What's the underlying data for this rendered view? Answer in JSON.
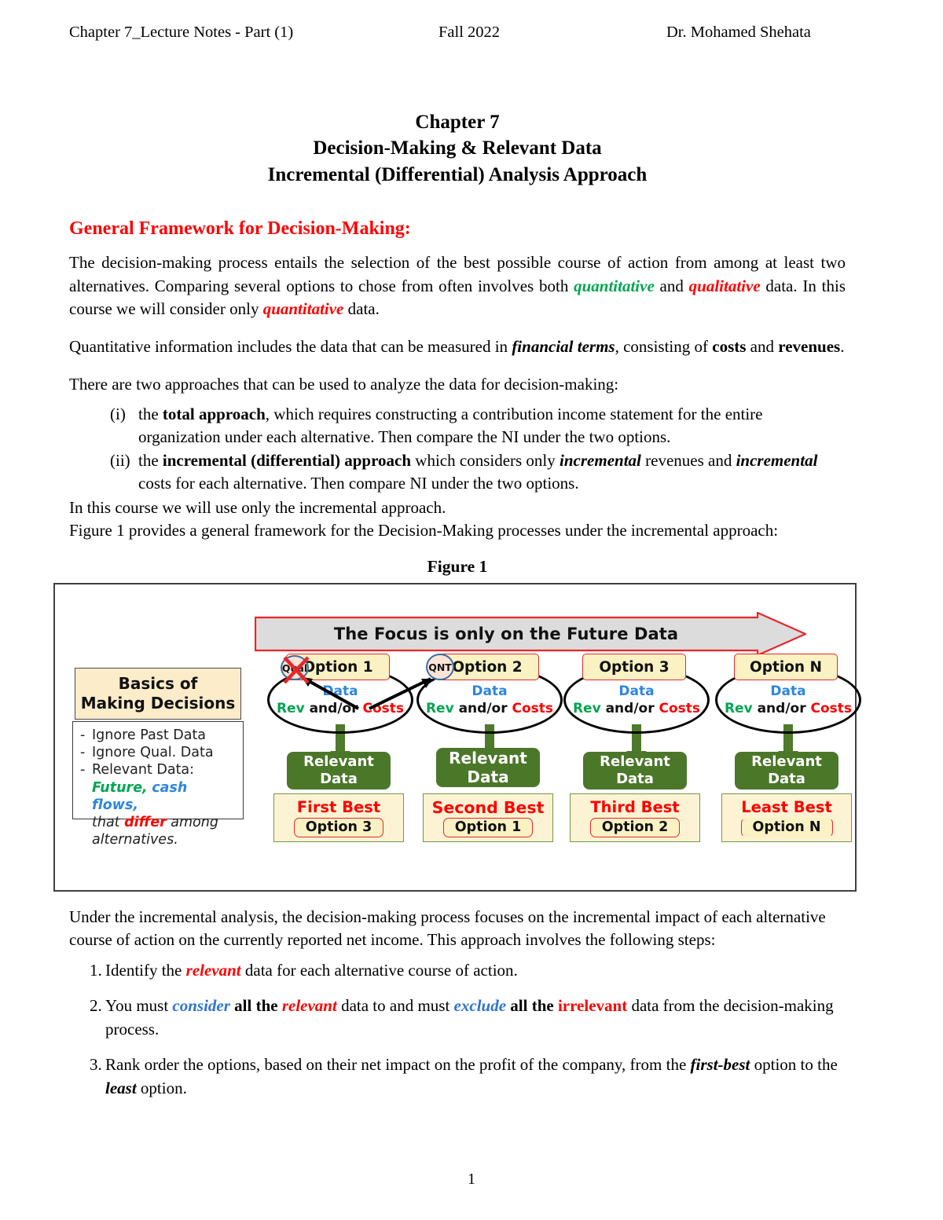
{
  "header": {
    "left": "Chapter 7_Lecture Notes - Part (1)",
    "middle": "Fall 2022",
    "right": "Dr. Mohamed Shehata"
  },
  "title": {
    "line1": "Chapter 7",
    "line2": "Decision-Making & Relevant Data",
    "line3": "Incremental (Differential) Analysis Approach"
  },
  "section_heading": "General Framework for Decision-Making:",
  "paragraphs": {
    "p1_a": "The decision-making process entails the selection of the best possible course of action from among at least two alternatives. Comparing several options to chose from often involves both ",
    "p1_quantitative": "quantitative",
    "p1_b": " and ",
    "p1_qualitative": "qualitative",
    "p1_c": " data. In this course we will consider only ",
    "p1_quantitative2": "quantitative",
    "p1_d": " data.",
    "p2_a": "Quantitative information includes the data that can be measured in ",
    "p2_financial": "financial terms",
    "p2_b": ", consisting of ",
    "p2_costs": "costs",
    "p2_c": " and ",
    "p2_revenues": "revenues",
    "p2_d": ".",
    "p3": "There are two approaches that can be used to analyze the data for decision-making:"
  },
  "approaches": [
    {
      "marker": "(i)",
      "a": "the ",
      "bold1": "total approach",
      "b": ", which requires constructing a contribution income statement for the entire organization under each alternative. Then compare the NI under the two options."
    },
    {
      "marker": "(ii)",
      "a": "the ",
      "bold1": "incremental (differential) approach",
      "b": " which considers only ",
      "it1": "incremental",
      "c": " revenues and ",
      "it2": "incremental",
      "d": " costs for each alternative. Then compare NI under the two options."
    }
  ],
  "after_list": "In this course we will use only the incremental approach.",
  "figure_intro": "Figure 1 provides a general framework for the Decision-Making processes under the incremental approach:",
  "figure_caption": "Figure 1",
  "figure": {
    "banner_text": "The Focus is only on the Future Data",
    "qual_circle": "Qual",
    "qnt_circle": "QNT",
    "basics": {
      "title_line1": "Basics of",
      "title_line2": "Making Decisions",
      "bullets": [
        "Ignore Past Data",
        "Ignore Qual. Data",
        "Relevant Data:"
      ],
      "detail_future": "Future,",
      "detail_cash": "cash flows,",
      "detail_that": "that ",
      "detail_differ": "differ",
      "detail_among": " among",
      "detail_alts": "alternatives."
    },
    "ellipse_labels": {
      "data": "Data",
      "rev": "Rev",
      "andor": " and/or ",
      "costs": "Costs"
    },
    "relevant_label_line1": "Relevant",
    "relevant_label_line2": "Data",
    "columns": [
      {
        "option": "Option 1",
        "rank": "First Best",
        "pick": "Option 3"
      },
      {
        "option": "Option 2",
        "rank": "Second Best",
        "pick": "Option 1"
      },
      {
        "option": "Option 3",
        "rank": "Third Best",
        "pick": "Option 2"
      },
      {
        "option": "Option N",
        "rank": "Least Best",
        "pick": "Option N"
      }
    ]
  },
  "after_figure": "Under the incremental analysis, the decision-making process focuses on the incremental impact of each alternative course of action on the currently reported net income. This approach involves the following steps:",
  "steps": [
    {
      "marker": "1.",
      "a": "Identify the ",
      "red_i": "relevant",
      "b": " data for each alternative course of action."
    },
    {
      "marker": "2.",
      "a": "You must ",
      "blue_i": "consider",
      "b": " all the ",
      "red_i": "relevant",
      "c": " data to and must ",
      "blue_i2": "exclude",
      "d": " all the ",
      "red_b": "irrelevant",
      "e": " data from the decision-making process."
    },
    {
      "marker": "3.",
      "a": "Rank order the options, based on their net impact on the profit of the company, from the ",
      "it1": "first-best",
      "b": " option to the ",
      "it2": "least",
      "c": " option."
    }
  ],
  "page_number": "1",
  "colors": {
    "accent_red": "#FF0000",
    "accent_green": "#00A651",
    "accent_blue": "#2E86DE",
    "box_green": "#4B7729",
    "box_cream": "#FBF2C4"
  }
}
